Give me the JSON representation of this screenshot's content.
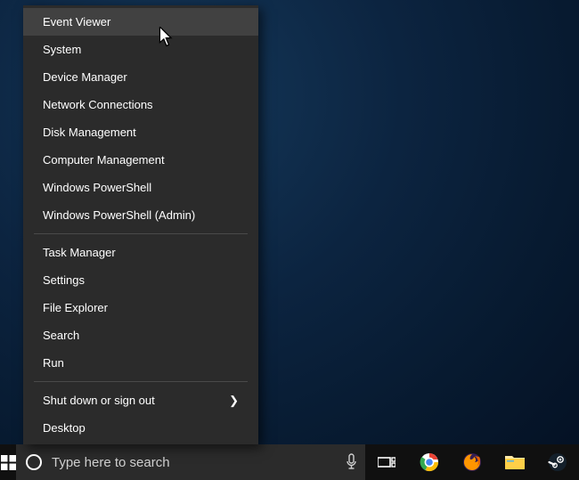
{
  "search": {
    "placeholder": "Type here to search"
  },
  "menu": {
    "hovered_index": 0,
    "groups": [
      [
        {
          "label": "Event Viewer",
          "submenu": false
        },
        {
          "label": "System",
          "submenu": false
        },
        {
          "label": "Device Manager",
          "submenu": false
        },
        {
          "label": "Network Connections",
          "submenu": false
        },
        {
          "label": "Disk Management",
          "submenu": false
        },
        {
          "label": "Computer Management",
          "submenu": false
        },
        {
          "label": "Windows PowerShell",
          "submenu": false
        },
        {
          "label": "Windows PowerShell (Admin)",
          "submenu": false
        }
      ],
      [
        {
          "label": "Task Manager",
          "submenu": false
        },
        {
          "label": "Settings",
          "submenu": false
        },
        {
          "label": "File Explorer",
          "submenu": false
        },
        {
          "label": "Search",
          "submenu": false
        },
        {
          "label": "Run",
          "submenu": false
        }
      ],
      [
        {
          "label": "Shut down or sign out",
          "submenu": true
        },
        {
          "label": "Desktop",
          "submenu": false
        }
      ]
    ]
  },
  "taskbar": {
    "icons": [
      {
        "name": "task-view-icon"
      },
      {
        "name": "chrome-icon"
      },
      {
        "name": "firefox-icon"
      },
      {
        "name": "file-explorer-icon"
      },
      {
        "name": "steam-icon"
      }
    ]
  },
  "colors": {
    "menu_bg": "#2b2b2b",
    "menu_hover": "#414141",
    "taskbar_bg": "#101010",
    "accent": "#0078d7"
  }
}
